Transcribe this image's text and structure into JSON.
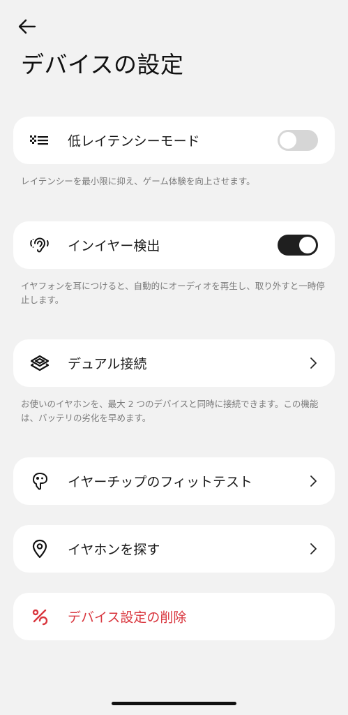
{
  "header": {
    "title": "デバイスの設定"
  },
  "settings": {
    "low_latency": {
      "label": "低レイテンシーモード",
      "enabled": false,
      "description": "レイテンシーを最小限に抑え、ゲーム体験を向上させます。"
    },
    "in_ear_detection": {
      "label": "インイヤー検出",
      "enabled": true,
      "description": "イヤフォンを耳につけると、自動的にオーディオを再生し、取り外すと一時停止します。"
    },
    "dual_connection": {
      "label": "デュアル接続",
      "description": "お使いのイヤホンを、最大 2 つのデバイスと同時に接続できます。この機能は、バッテリの劣化を早めます。"
    },
    "ear_tip_fit_test": {
      "label": "イヤーチップのフィットテスト"
    },
    "find_earphones": {
      "label": "イヤホンを探す"
    },
    "delete_device_settings": {
      "label": "デバイス設定の削除"
    }
  },
  "colors": {
    "background": "#f2f2f2",
    "card": "#ffffff",
    "danger": "#d9363e",
    "toggle_on": "#1f1f1f",
    "toggle_off": "#d6d6d6"
  },
  "icons": {
    "back": "arrow-left-icon",
    "low_latency": "low-latency-icon",
    "in_ear_detection": "ear-detection-icon",
    "dual_connection": "layers-icon",
    "ear_tip_fit_test": "ear-tip-icon",
    "find_earphones": "location-pin-icon",
    "delete_device_settings": "delete-settings-icon"
  }
}
